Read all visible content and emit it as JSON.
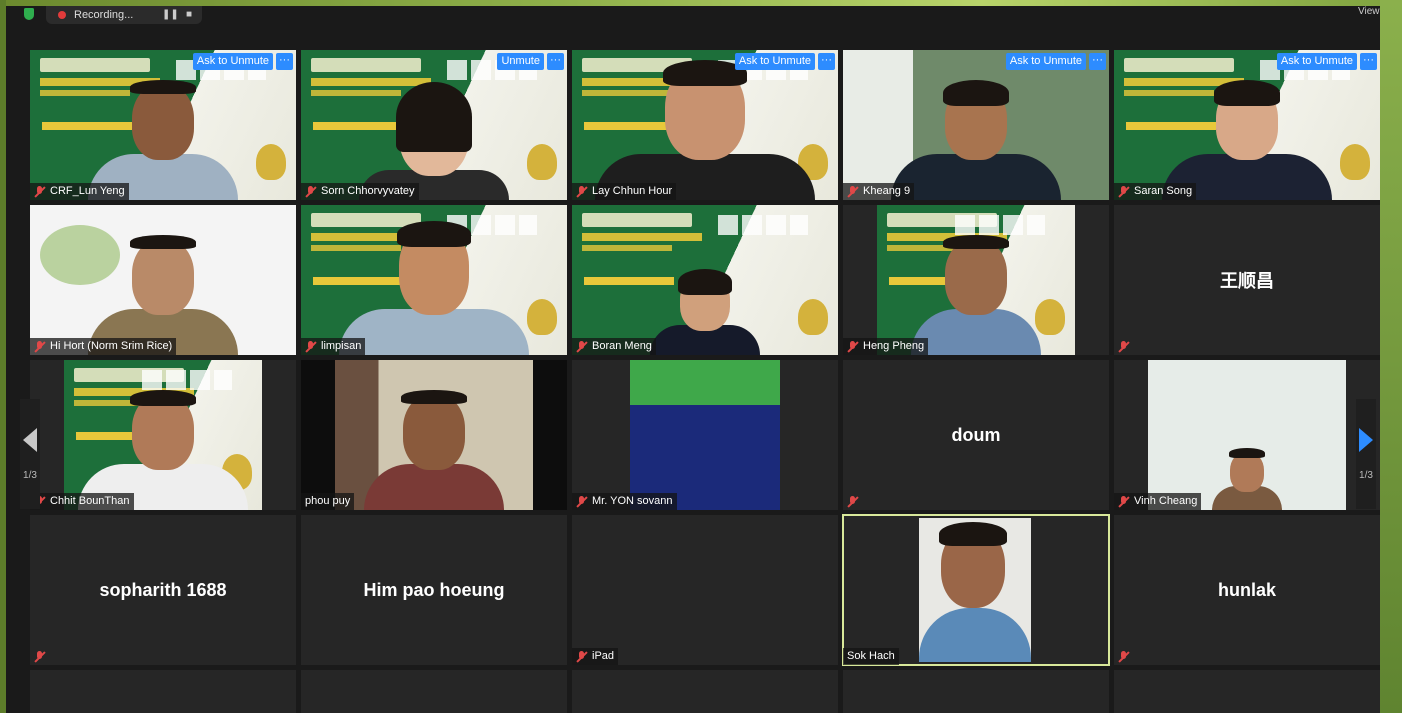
{
  "toolbar": {
    "recording_label": "Recording...",
    "view_label": "View"
  },
  "unmute_label": "Ask to Unmute",
  "unmute_short": "Unmute",
  "more_label": "···",
  "pagination": {
    "left": "1/3",
    "right": "1/3"
  },
  "participants": [
    {
      "name": "CRF_Lun Yeng"
    },
    {
      "name": "Sorn Chhorvyvatey"
    },
    {
      "name": "Lay Chhun Hour"
    },
    {
      "name": "Kheang 9"
    },
    {
      "name": "Saran Song"
    },
    {
      "name": "Hi Hort (Norm Srim Rice)"
    },
    {
      "name": "limpisan"
    },
    {
      "name": "Boran Meng"
    },
    {
      "name": "Heng Pheng"
    },
    {
      "name": "",
      "display_name": "王顺昌"
    },
    {
      "name": "Chhit BounThan"
    },
    {
      "name": "phou puy"
    },
    {
      "name": "Mr. YON sovann"
    },
    {
      "name": "",
      "display_name": "doum"
    },
    {
      "name": "Vinh Cheang"
    },
    {
      "name": "",
      "display_name": "sopharith 1688"
    },
    {
      "name": "",
      "display_name": "Him pao hoeung"
    },
    {
      "name": "iPad"
    },
    {
      "name": "Sok Hach"
    },
    {
      "name": "",
      "display_name": "hunlak"
    }
  ],
  "colors": {
    "accent": "#2d8cff",
    "active_speaker": "#d8e89a",
    "mute": "#e04848"
  }
}
